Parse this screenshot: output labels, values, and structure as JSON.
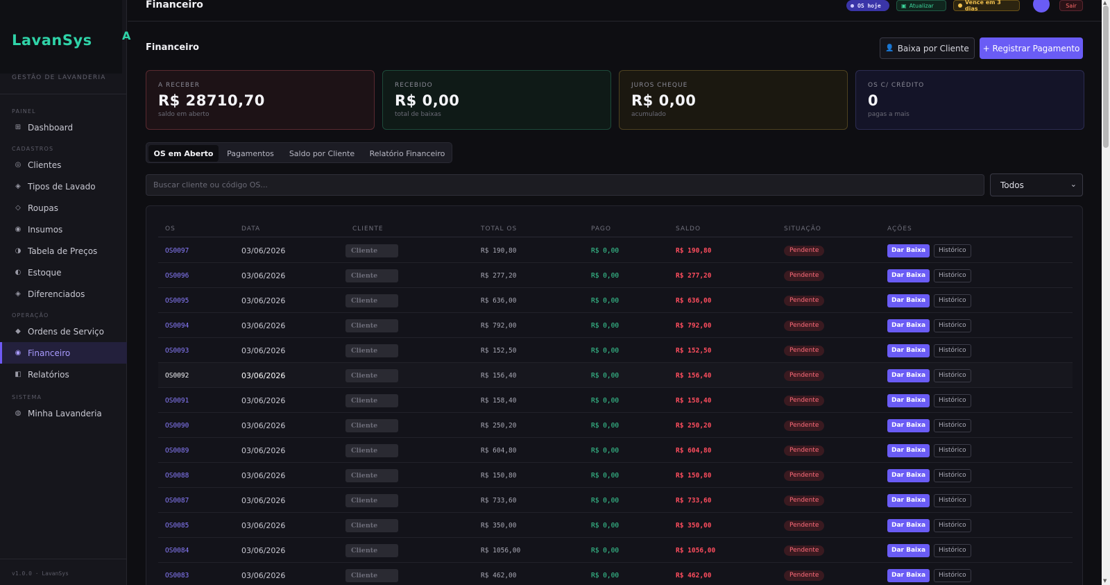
{
  "sidebar": {
    "brand": "LavanSys",
    "brand_mark": "A",
    "subtitle": "GESTÃO DE LAVANDERIA",
    "sections": [
      {
        "label": "PAINEL"
      },
      {
        "label": "CADASTROS"
      },
      {
        "label": "OPERAÇÃO"
      },
      {
        "label": "SISTEMA"
      }
    ],
    "items": [
      {
        "label": "Dashboard",
        "icon": "grid-icon"
      },
      {
        "label": "Clientes",
        "icon": "users-icon"
      },
      {
        "label": "Tipos de Lavado",
        "icon": "diamond-icon"
      },
      {
        "label": "Roupas",
        "icon": "shirt-icon"
      },
      {
        "label": "Insumos",
        "icon": "flask-icon"
      },
      {
        "label": "Tabela de Preços",
        "icon": "tag-icon"
      },
      {
        "label": "Estoque",
        "icon": "box-icon"
      },
      {
        "label": "Diferenciados",
        "icon": "star-icon"
      },
      {
        "label": "Ordens de Serviço",
        "icon": "clipboard-icon"
      },
      {
        "label": "Financeiro",
        "icon": "money-icon"
      },
      {
        "label": "Relatórios",
        "icon": "report-icon"
      },
      {
        "label": "Minha Lavanderia",
        "icon": "store-icon"
      }
    ],
    "footer": "v1.0.0 · LavanSys"
  },
  "topbar": {
    "title": "Financeiro",
    "os_hoje": "OS hoje",
    "atualizar": "Atualizar",
    "vence": "Vence em 3 dias",
    "sair": "Sair"
  },
  "page": {
    "title": "Financeiro",
    "btn_baixa_cliente": "Baixa por Cliente",
    "btn_registrar": "+ Registrar Pagamento"
  },
  "stats": [
    {
      "label": "A RECEBER",
      "value": "R$ 28710,70",
      "sub": "saldo em aberto"
    },
    {
      "label": "RECEBIDO",
      "value": "R$ 0,00",
      "sub": "total de baixas"
    },
    {
      "label": "JUROS CHEQUE",
      "value": "R$ 0,00",
      "sub": "acumulado"
    },
    {
      "label": "OS C/ CRÉDITO",
      "value": "0",
      "sub": "pagas a mais"
    }
  ],
  "tabs": [
    "OS em Aberto",
    "Pagamentos",
    "Saldo por Cliente",
    "Relatório Financeiro"
  ],
  "search": {
    "placeholder": "Buscar cliente ou código OS..."
  },
  "filter": {
    "selected": "Todos"
  },
  "table": {
    "headers": [
      "OS",
      "DATA",
      "CLIENTE",
      "TOTAL OS",
      "PAGO",
      "SALDO",
      "SITUAÇÃO",
      "AÇÕES"
    ],
    "rows": [
      {
        "os": "OS0097",
        "data": "03/06/2026",
        "cliente": "Cliente",
        "total": "R$ 190,80",
        "pago": "R$ 0,00",
        "saldo": "R$ 190,80",
        "situacao": "Pendente",
        "baixa": "Dar Baixa",
        "historico": "Histórico"
      },
      {
        "os": "OS0096",
        "data": "03/06/2026",
        "cliente": "Cliente",
        "total": "R$ 277,20",
        "pago": "R$ 0,00",
        "saldo": "R$ 277,20",
        "situacao": "Pendente",
        "baixa": "Dar Baixa",
        "historico": "Histórico"
      },
      {
        "os": "OS0095",
        "data": "03/06/2026",
        "cliente": "Cliente",
        "total": "R$ 636,00",
        "pago": "R$ 0,00",
        "saldo": "R$ 636,00",
        "situacao": "Pendente",
        "baixa": "Dar Baixa",
        "historico": "Histórico"
      },
      {
        "os": "OS0094",
        "data": "03/06/2026",
        "cliente": "Cliente",
        "total": "R$ 792,00",
        "pago": "R$ 0,00",
        "saldo": "R$ 792,00",
        "situacao": "Pendente",
        "baixa": "Dar Baixa",
        "historico": "Histórico"
      },
      {
        "os": "OS0093",
        "data": "03/06/2026",
        "cliente": "Cliente",
        "total": "R$ 152,50",
        "pago": "R$ 0,00",
        "saldo": "R$ 152,50",
        "situacao": "Pendente",
        "baixa": "Dar Baixa",
        "historico": "Histórico"
      },
      {
        "os": "OS0092",
        "data": "03/06/2026",
        "cliente": "Cliente",
        "total": "R$ 156,40",
        "pago": "R$ 0,00",
        "saldo": "R$ 156,40",
        "situacao": "Pendente",
        "baixa": "Dar Baixa",
        "historico": "Histórico"
      },
      {
        "os": "OS0091",
        "data": "03/06/2026",
        "cliente": "Cliente",
        "total": "R$ 158,40",
        "pago": "R$ 0,00",
        "saldo": "R$ 158,40",
        "situacao": "Pendente",
        "baixa": "Dar Baixa",
        "historico": "Histórico"
      },
      {
        "os": "OS0090",
        "data": "03/06/2026",
        "cliente": "Cliente",
        "total": "R$ 250,20",
        "pago": "R$ 0,00",
        "saldo": "R$ 250,20",
        "situacao": "Pendente",
        "baixa": "Dar Baixa",
        "historico": "Histórico"
      },
      {
        "os": "OS0089",
        "data": "03/06/2026",
        "cliente": "Cliente",
        "total": "R$ 604,80",
        "pago": "R$ 0,00",
        "saldo": "R$ 604,80",
        "situacao": "Pendente",
        "baixa": "Dar Baixa",
        "historico": "Histórico"
      },
      {
        "os": "OS0088",
        "data": "03/06/2026",
        "cliente": "Cliente",
        "total": "R$ 150,80",
        "pago": "R$ 0,00",
        "saldo": "R$ 150,80",
        "situacao": "Pendente",
        "baixa": "Dar Baixa",
        "historico": "Histórico"
      },
      {
        "os": "OS0087",
        "data": "03/06/2026",
        "cliente": "Cliente",
        "total": "R$ 733,60",
        "pago": "R$ 0,00",
        "saldo": "R$ 733,60",
        "situacao": "Pendente",
        "baixa": "Dar Baixa",
        "historico": "Histórico"
      },
      {
        "os": "OS0085",
        "data": "03/06/2026",
        "cliente": "Cliente",
        "total": "R$ 350,00",
        "pago": "R$ 0,00",
        "saldo": "R$ 350,00",
        "situacao": "Pendente",
        "baixa": "Dar Baixa",
        "historico": "Histórico"
      },
      {
        "os": "OS0084",
        "data": "03/06/2026",
        "cliente": "Cliente",
        "total": "R$ 1056,00",
        "pago": "R$ 0,00",
        "saldo": "R$ 1056,00",
        "situacao": "Pendente",
        "baixa": "Dar Baixa",
        "historico": "Histórico"
      },
      {
        "os": "OS0083",
        "data": "03/06/2026",
        "cliente": "Cliente",
        "total": "R$ 462,00",
        "pago": "R$ 0,00",
        "saldo": "R$ 462,00",
        "situacao": "Pendente",
        "baixa": "Dar Baixa",
        "historico": "Histórico"
      }
    ]
  }
}
